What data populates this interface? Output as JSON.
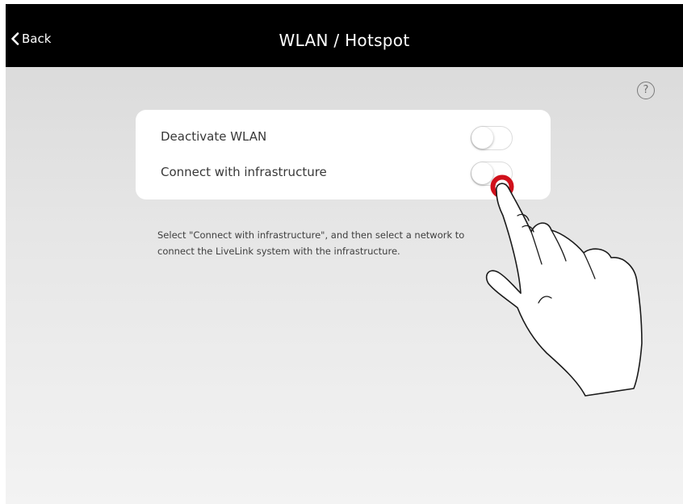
{
  "navbar": {
    "back_label": "Back",
    "title": "WLAN / Hotspot"
  },
  "help": {
    "label": "?"
  },
  "settings": {
    "rows": [
      {
        "label": "Deactivate WLAN",
        "toggle_on": false
      },
      {
        "label": "Connect with infrastructure",
        "toggle_on": false
      }
    ]
  },
  "description": {
    "line1": "Select \"Connect with infrastructure\", and then select a network to",
    "line2": "connect the LiveLink system with the infrastructure."
  },
  "colors": {
    "navbar": "#000000",
    "tap_indicator": "#d0101b"
  },
  "icons": {
    "back": "chevron-left-icon",
    "help": "question-circle-icon",
    "gesture": "tap-hand-icon"
  }
}
